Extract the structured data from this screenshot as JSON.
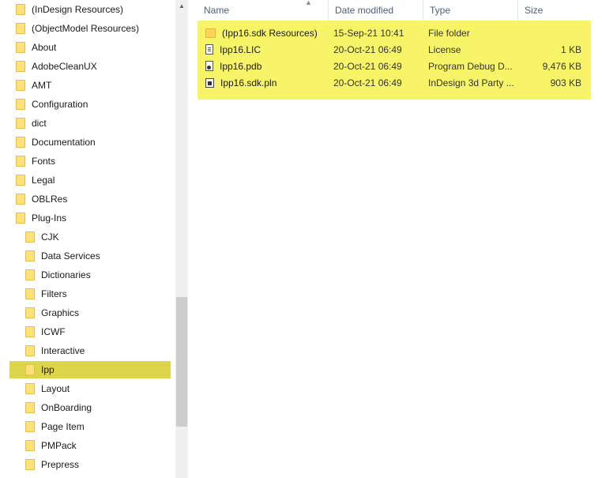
{
  "nav": {
    "items": [
      {
        "label": "(InDesign Resources)",
        "indent": 0
      },
      {
        "label": "(ObjectModel Resources)",
        "indent": 0
      },
      {
        "label": "About",
        "indent": 0
      },
      {
        "label": "AdobeCleanUX",
        "indent": 0
      },
      {
        "label": "AMT",
        "indent": 0
      },
      {
        "label": "Configuration",
        "indent": 0
      },
      {
        "label": "dict",
        "indent": 0
      },
      {
        "label": "Documentation",
        "indent": 0
      },
      {
        "label": "Fonts",
        "indent": 0
      },
      {
        "label": "Legal",
        "indent": 0
      },
      {
        "label": "OBLRes",
        "indent": 0
      },
      {
        "label": "Plug-Ins",
        "indent": 0
      },
      {
        "label": "CJK",
        "indent": 1
      },
      {
        "label": "Data Services",
        "indent": 1
      },
      {
        "label": "Dictionaries",
        "indent": 1
      },
      {
        "label": "Filters",
        "indent": 1
      },
      {
        "label": "Graphics",
        "indent": 1
      },
      {
        "label": "ICWF",
        "indent": 1
      },
      {
        "label": "Interactive",
        "indent": 1
      },
      {
        "label": "Ipp",
        "indent": 1,
        "selected": true
      },
      {
        "label": "Layout",
        "indent": 1
      },
      {
        "label": "OnBoarding",
        "indent": 1
      },
      {
        "label": "Page Item",
        "indent": 1
      },
      {
        "label": "PMPack",
        "indent": 1
      },
      {
        "label": "Prepress",
        "indent": 1
      }
    ]
  },
  "columns": {
    "name": "Name",
    "date": "Date modified",
    "type": "Type",
    "size": "Size"
  },
  "files": [
    {
      "name": "(Ipp16.sdk Resources)",
      "date": "15-Sep-21 10:41",
      "type": "File folder",
      "size": "",
      "icon": "folder-icon"
    },
    {
      "name": "Ipp16.LIC",
      "date": "20-Oct-21 06:49",
      "type": "License",
      "size": "1 KB",
      "icon": "document-icon"
    },
    {
      "name": "Ipp16.pdb",
      "date": "20-Oct-21 06:49",
      "type": "Program Debug D...",
      "size": "9,476 KB",
      "icon": "debug-file-icon"
    },
    {
      "name": "Ipp16.sdk.pln",
      "date": "20-Oct-21 06:49",
      "type": "InDesign 3d Party ...",
      "size": "903 KB",
      "icon": "plugin-file-icon"
    }
  ],
  "colors": {
    "selection": "#ddd54a",
    "highlight": "#f8f467",
    "folder": "#ffe17a",
    "header_text": "#4c607a"
  }
}
